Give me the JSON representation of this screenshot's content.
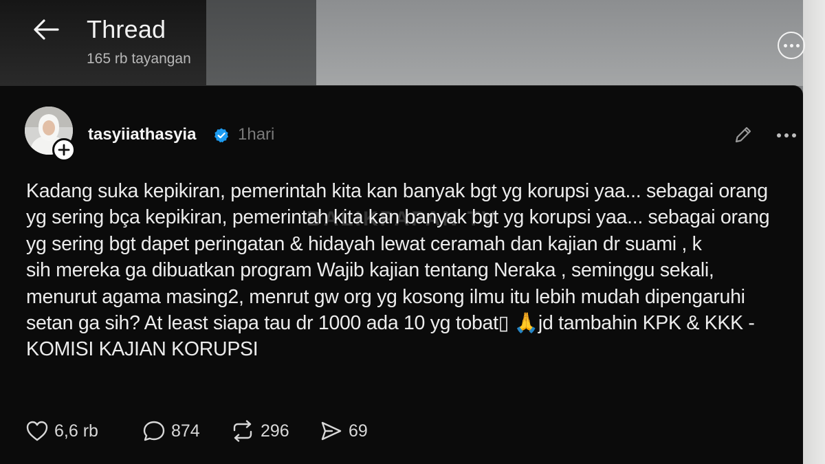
{
  "header": {
    "title": "Thread",
    "views": "165 rb tayangan"
  },
  "post": {
    "username": "tasyiiathasyia",
    "time": "1hari",
    "lines": [
      "Kadang suka kepikiran, pemerintah kita kan banyak bgt yg korupsi yaa... sebagai orang",
      "yg sering bça kepikiran, pemerintah kita kan banyak bgt yg korupsi yaa... sebagai orang",
      "yg sering bgt dapet peringatan & hidayah lewat ceramah dan kajian dr suami , k",
      "sih mereka ga dibuatkan program Wajib kajian tentang Neraka , seminggu sekali,",
      "menurut agama masing2, menrut gw org yg kosong ilmu itu lebih mudah dipengaruhi",
      "setan ga sih? At least siapa tau dr 1000 ada 10 yg tobat",
      "KOMISI KAJIAN KORUPSI"
    ],
    "line6_tail": "jd tambahin KPK & KKK -",
    "emoji_box": "▯",
    "emoji_pray": "🙏",
    "watermark": "BALIKPAPAN TV",
    "likes": "6,6 rb",
    "replies": "874",
    "reposts": "296",
    "shares": "69"
  },
  "colors": {
    "card_bg": "#0b0b0b",
    "verified": "#1d9bf0",
    "text": "#ececec",
    "muted": "#7a7a7a"
  },
  "icons": [
    "back-arrow-icon",
    "options-icon",
    "add-icon",
    "verified-icon",
    "edit-icon",
    "more-icon",
    "heart-icon",
    "reply-icon",
    "repost-icon",
    "share-icon"
  ]
}
